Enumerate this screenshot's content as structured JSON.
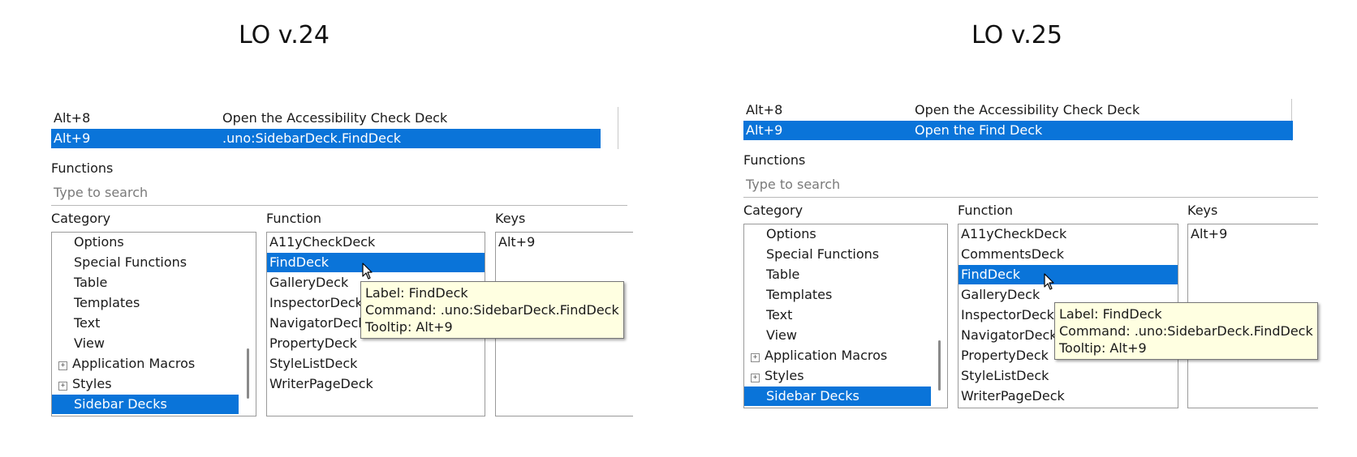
{
  "left": {
    "heading": "LO v.24",
    "shortcut_rows": [
      {
        "key": "Alt+8",
        "command": "Open the Accessibility Check Deck",
        "selected": false
      },
      {
        "key": "Alt+9",
        "command": ".uno:SidebarDeck.FindDeck",
        "selected": true
      }
    ],
    "functions_label": "Functions",
    "search_placeholder": "Type to search",
    "category_label": "Category",
    "function_label": "Function",
    "keys_label": "Keys",
    "categories": [
      {
        "label": "Options",
        "expander": ""
      },
      {
        "label": "Special Functions",
        "expander": ""
      },
      {
        "label": "Table",
        "expander": ""
      },
      {
        "label": "Templates",
        "expander": ""
      },
      {
        "label": "Text",
        "expander": ""
      },
      {
        "label": "View",
        "expander": ""
      },
      {
        "label": "Application Macros",
        "expander": "+"
      },
      {
        "label": "Styles",
        "expander": "+"
      },
      {
        "label": "Sidebar Decks",
        "expander": ""
      }
    ],
    "functions": [
      "A11yCheckDeck",
      "FindDeck",
      "GalleryDeck",
      "InspectorDeck",
      "NavigatorDeck",
      "PropertyDeck",
      "StyleListDeck",
      "WriterPageDeck"
    ],
    "keys": [
      "Alt+9"
    ],
    "tooltip": {
      "line1": "Label: FindDeck",
      "line2": "Command: .uno:SidebarDeck.FindDeck",
      "line3": "Tooltip: Alt+9"
    }
  },
  "right": {
    "heading": "LO v.25",
    "shortcut_rows": [
      {
        "key": "Alt+8",
        "command": "Open the Accessibility Check Deck",
        "selected": false
      },
      {
        "key": "Alt+9",
        "command": "Open the Find Deck",
        "selected": true
      }
    ],
    "functions_label": "Functions",
    "search_placeholder": "Type to search",
    "category_label": "Category",
    "function_label": "Function",
    "keys_label": "Keys",
    "categories": [
      {
        "label": "Options",
        "expander": ""
      },
      {
        "label": "Special Functions",
        "expander": ""
      },
      {
        "label": "Table",
        "expander": ""
      },
      {
        "label": "Templates",
        "expander": ""
      },
      {
        "label": "Text",
        "expander": ""
      },
      {
        "label": "View",
        "expander": ""
      },
      {
        "label": "Application Macros",
        "expander": "+"
      },
      {
        "label": "Styles",
        "expander": "+"
      },
      {
        "label": "Sidebar Decks",
        "expander": ""
      }
    ],
    "functions": [
      "A11yCheckDeck",
      "CommentsDeck",
      "FindDeck",
      "GalleryDeck",
      "InspectorDeck",
      "NavigatorDeck",
      "PropertyDeck",
      "StyleListDeck",
      "WriterPageDeck"
    ],
    "keys": [
      "Alt+9"
    ],
    "tooltip": {
      "line1": "Label: FindDeck",
      "line2": "Command: .uno:SidebarDeck.FindDeck",
      "line3": "Tooltip: Alt+9"
    }
  },
  "colors": {
    "selection": "#0a74d9",
    "tooltip_bg": "#ffffe1"
  }
}
